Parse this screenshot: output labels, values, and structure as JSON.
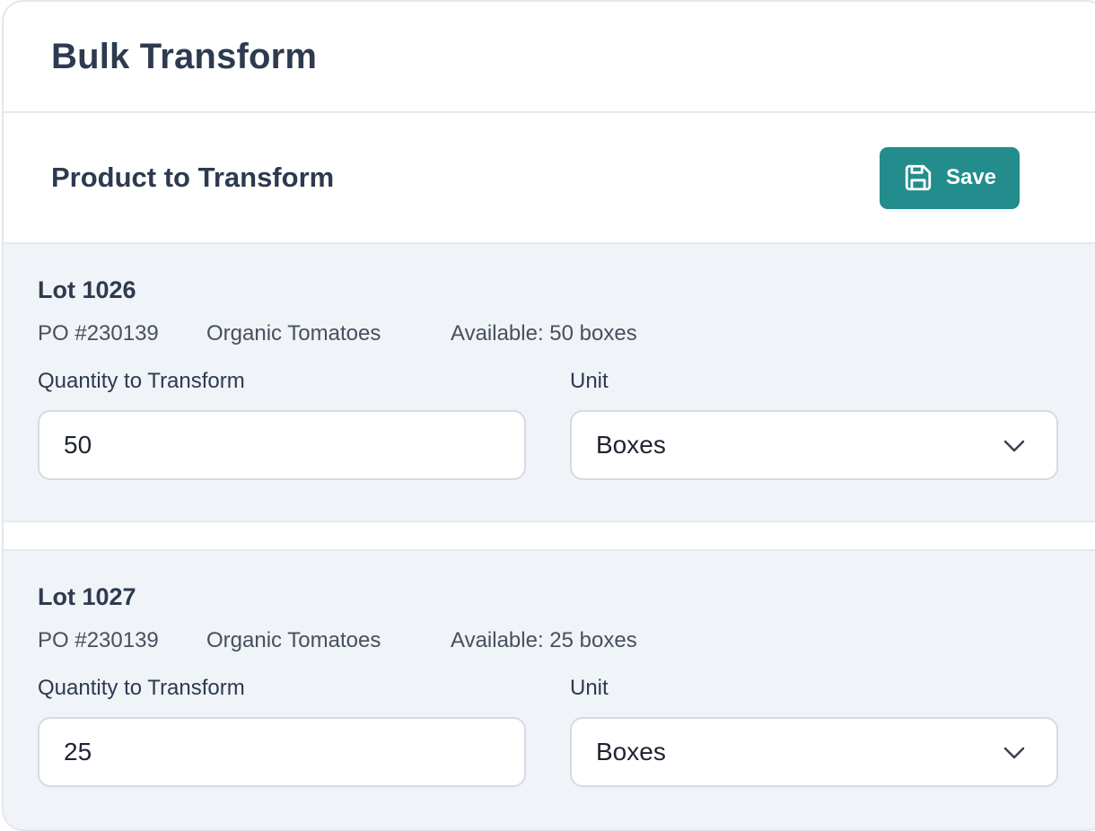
{
  "header": {
    "title": "Bulk Transform"
  },
  "section": {
    "title": "Product to Transform",
    "save_label": "Save"
  },
  "lots": [
    {
      "title": "Lot 1026",
      "po": "PO #230139",
      "product": "Organic Tomatoes",
      "available": "Available: 50 boxes",
      "quantity_label": "Quantity to Transform",
      "quantity_value": "50",
      "unit_label": "Unit",
      "unit_value": "Boxes"
    },
    {
      "title": "Lot 1027",
      "po": "PO #230139",
      "product": "Organic Tomatoes",
      "available": "Available: 25 boxes",
      "quantity_label": "Quantity to Transform",
      "quantity_value": "25",
      "unit_label": "Unit",
      "unit_value": "Boxes"
    }
  ],
  "colors": {
    "accent": "#238c8c",
    "lot_background": "#f0f3f8",
    "text": "#2d3a4f"
  },
  "icons": {
    "save": "floppy-disk-icon",
    "dropdown": "chevron-down-icon"
  }
}
